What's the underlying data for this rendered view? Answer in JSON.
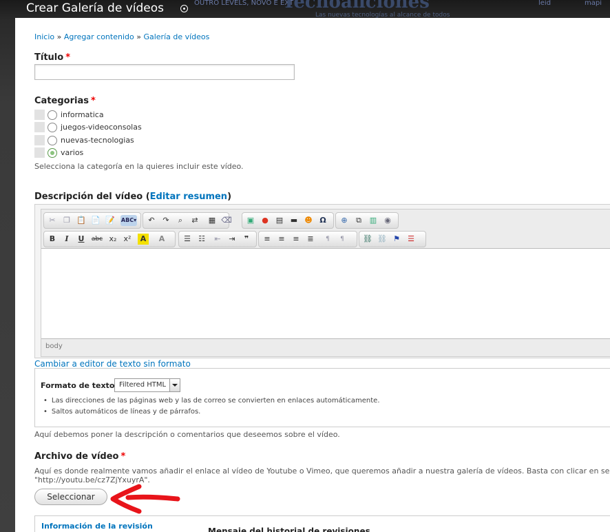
{
  "background": {
    "texts": [
      "OUTRO LEVELS, NOVO E EXT",
      "leid",
      "mapi",
      "Tecnoaficiones",
      "Las nuevas tecnologías al alcance de todos"
    ]
  },
  "overlay": {
    "title": "Crear Galería de vídeos"
  },
  "breadcrumb": {
    "home": "Inicio",
    "sep1": " » ",
    "add": "Agregar contenido",
    "sep2": " » ",
    "current": "Galería de vídeos"
  },
  "titulo": {
    "label": "Título",
    "required": "*",
    "value": ""
  },
  "categorias": {
    "label": "Categorias",
    "required": "*",
    "options": [
      {
        "label": "informatica",
        "checked": false
      },
      {
        "label": "juegos-videoconsolas",
        "checked": false
      },
      {
        "label": "nuevas-tecnologias",
        "checked": false
      },
      {
        "label": "varios",
        "checked": true
      }
    ],
    "description": "Selecciona la categoría en la quieres incluir este vídeo."
  },
  "descripcion": {
    "label": "Descripción del vídeo (",
    "edit_summary": "Editar resumen",
    "label_close": ")",
    "toolbar_row1": [
      "cut-icon",
      "copy-icon",
      "paste-icon",
      "paste-text-icon",
      "paste-word-icon",
      "spellcheck-icon",
      "undo-icon",
      "redo-icon",
      "find-icon",
      "replace-icon",
      "select-all-icon",
      "remove-format-icon",
      "image-icon",
      "flash-icon",
      "table-icon",
      "horizontal-rule-icon",
      "smiley-icon",
      "special-char-icon",
      "maximize-icon",
      "show-blocks-icon",
      "templates-icon",
      "iframe-icon"
    ],
    "toolbar_row2_text": {
      "bold": "B",
      "italic": "I",
      "underline": "U",
      "strike": "abc",
      "subscript": "x₂",
      "superscript": "x²",
      "text_color": "A",
      "bg_color": "A",
      "quote": "❞"
    },
    "path_label": "body",
    "switch_link": "Cambiar a editor de texto sin formato",
    "format_label": "Formato de texto",
    "format_value": "Filtered HTML",
    "tips": [
      "Las direcciones de las páginas web y las de correo se convierten en enlaces automáticamente.",
      "Saltos automáticos de líneas y de párrafos."
    ],
    "help": "Aquí debemos poner la descripción o comentarios que deseemos sobre el vídeo."
  },
  "archivo": {
    "label": "Archivo de vídeo",
    "required": "*",
    "description_line1": "Aquí es donde realmente vamos añadir el enlace al vídeo de Youtube o Vimeo, que queremos añadir a nuestra galería de vídeos. Basta con clicar en selec",
    "description_line2": "\"http://youtu.be/cz7ZjYxuyrA\".",
    "button": "Seleccionar"
  },
  "revision": {
    "tab_label": "Información de la revisión",
    "message_label": "Mensaje del historial de revisiones"
  },
  "colors": {
    "link": "#0074bd",
    "required": "#e00000",
    "annotation": "#e8141a"
  }
}
